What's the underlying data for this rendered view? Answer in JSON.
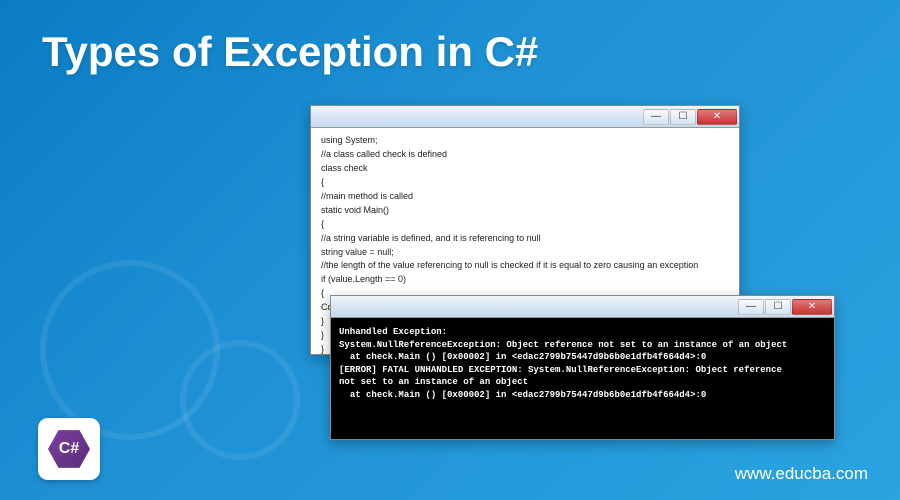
{
  "title": "Types of Exception in C#",
  "code_window": {
    "lines": "using System;\n//a class called check is defined\nclass check\n{\n//main method is called\nstatic void Main()\n{\n//a string variable is defined, and it is referencing to null\nstring value = null;\n//the length of the value referencing to null is checked if it is equal to zero causing an exception\nif (value.Length == 0)\n{\nConsole.WriteLin\n}\n}\n}"
  },
  "console_window": {
    "output": "Unhandled Exception:\nSystem.NullReferenceException: Object reference not set to an instance of an object\n  at check.Main () [0x00002] in <edac2799b75447d9b6b0e1dfb4f664d4>:0\n[ERROR] FATAL UNHANDLED EXCEPTION: System.NullReferenceException: Object reference\nnot set to an instance of an object\n  at check.Main () [0x00002] in <edac2799b75447d9b6b0e1dfb4f664d4>:0"
  },
  "logo": {
    "text": "C#"
  },
  "url": "www.educba.com",
  "buttons": {
    "min": "—",
    "max": "☐",
    "close": "✕"
  }
}
